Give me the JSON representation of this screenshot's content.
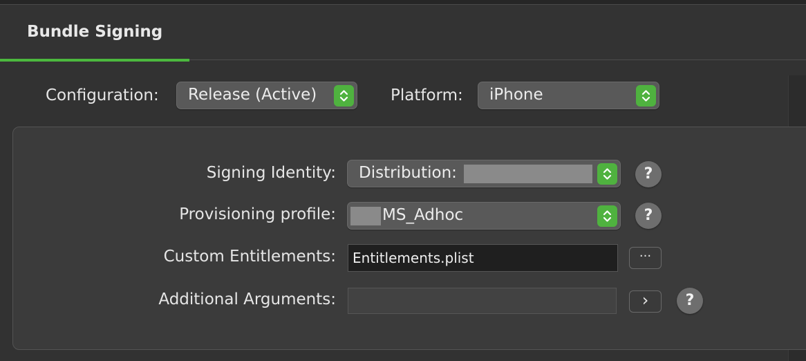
{
  "tab": {
    "label": "Bundle Signing",
    "accent": "#4cb83e"
  },
  "config": {
    "configuration_label": "Configuration:",
    "configuration_value": "Release (Active)",
    "platform_label": "Platform:",
    "platform_value": "iPhone"
  },
  "signing": {
    "identity_label": "Signing Identity:",
    "identity_value": "Distribution:",
    "profile_label": "Provisioning profile:",
    "profile_value": "MS_Adhoc",
    "entitlements_label": "Custom Entitlements:",
    "entitlements_value": "Entitlements.plist",
    "entitlements_button": "···",
    "arguments_label": "Additional Arguments:",
    "arguments_value": "",
    "arguments_button": "›",
    "help_glyph": "?"
  },
  "icons": {
    "popup_indicator": "up-down-chevron-icon",
    "help": "question-mark-icon",
    "more": "ellipsis-icon",
    "expand": "chevron-right-icon"
  }
}
